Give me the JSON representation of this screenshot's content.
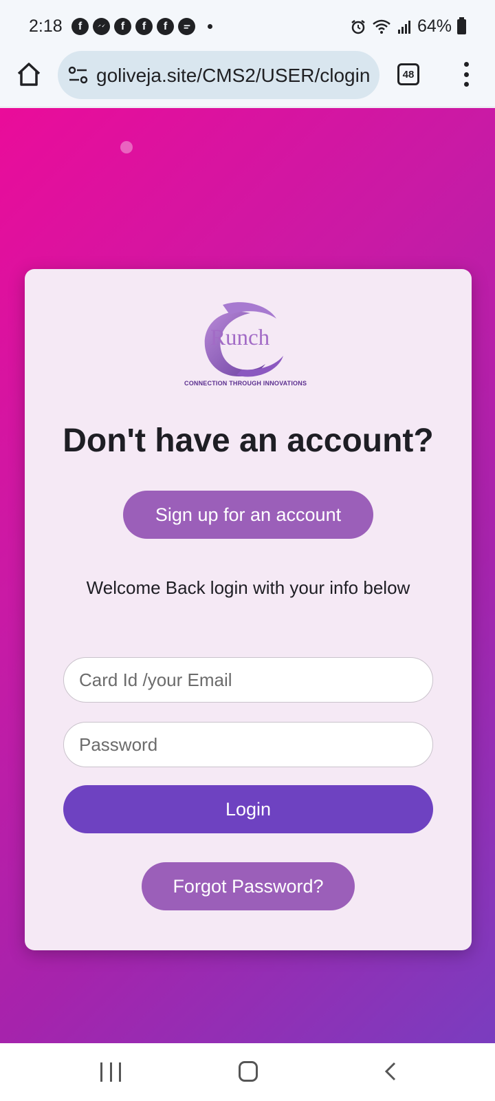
{
  "status_bar": {
    "time": "2:18",
    "notification_icons": [
      "facebook-icon",
      "messenger-icon",
      "facebook-icon",
      "facebook-icon",
      "facebook-icon",
      "chat-icon"
    ],
    "battery": "64%"
  },
  "browser": {
    "url": "goliveja.site/CMS2/USER/clogin",
    "tab_count": "48"
  },
  "logo": {
    "wordmark": "Runch",
    "tagline": "CONNECTION THROUGH INNOVATIONS"
  },
  "card": {
    "headline": "Don't have an account?",
    "signup_label": "Sign up for an account",
    "welcome_text": "Welcome Back login with your info below",
    "email_placeholder": "Card Id /your Email",
    "password_placeholder": "Password",
    "login_label": "Login",
    "forgot_label": "Forgot Password?"
  },
  "colors": {
    "gradient_start": "#ea0c9a",
    "gradient_end": "#7a3dbf",
    "card_bg": "#f5e9f5",
    "button_purple": "#9b5fb9",
    "login_purple": "#6e42c1"
  }
}
